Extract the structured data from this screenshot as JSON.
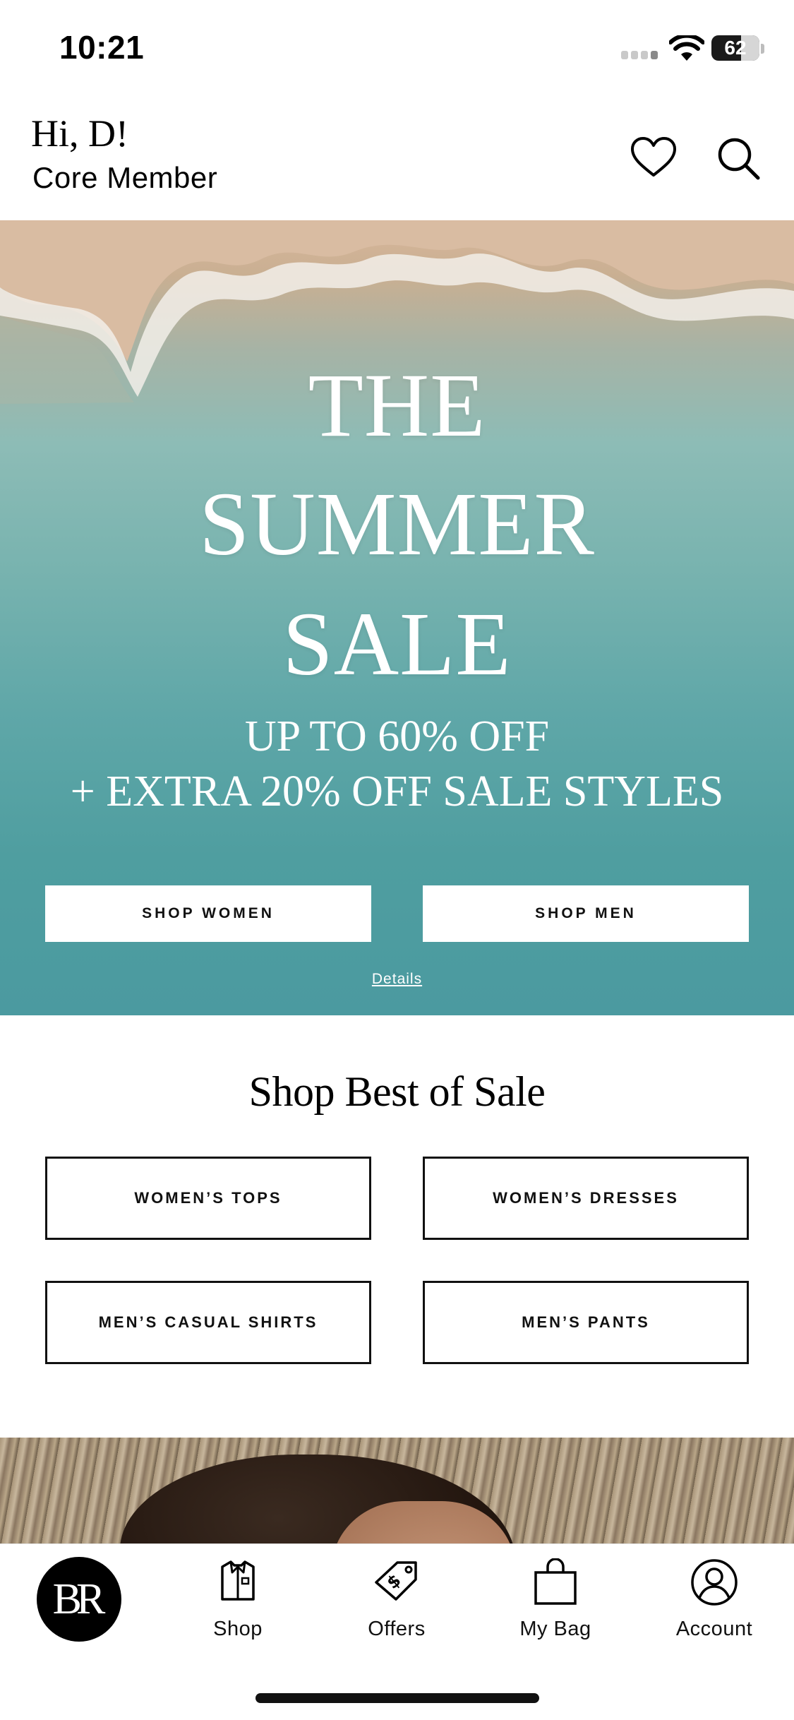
{
  "status_bar": {
    "time": "10:21",
    "battery": "62",
    "battery_level": 0.62
  },
  "header": {
    "greeting": "Hi, D!",
    "member_level": "Core Member"
  },
  "hero": {
    "title_line1": "THE",
    "title_line2": "SUMMER",
    "title_line3": "SALE",
    "subtitle_line1": "UP TO 60% OFF",
    "subtitle_line2": "+ EXTRA 20% OFF SALE STYLES",
    "shop_women": "SHOP WOMEN",
    "shop_men": "SHOP MEN",
    "details": "Details"
  },
  "best_of_sale": {
    "title": "Shop Best of Sale",
    "categories": [
      "WOMEN’S TOPS",
      "WOMEN’S DRESSES",
      "MEN’S CASUAL SHIRTS",
      "MEN’S PANTS"
    ]
  },
  "tab_bar": {
    "logo": "BR",
    "tabs": [
      {
        "label": "Shop",
        "icon": "shirt-icon"
      },
      {
        "label": "Offers",
        "icon": "price-tag-icon"
      },
      {
        "label": "My Bag",
        "icon": "shopping-bag-icon"
      },
      {
        "label": "Account",
        "icon": "account-icon"
      }
    ]
  },
  "colors": {
    "accent": "#000000",
    "hero_sea": "#5fa7a8",
    "sand": "#d8b79b"
  }
}
